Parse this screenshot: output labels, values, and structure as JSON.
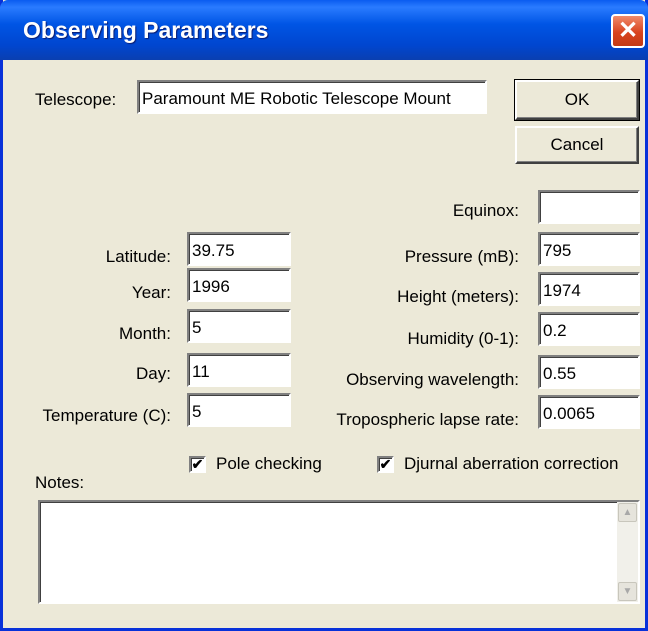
{
  "window": {
    "title": "Observing Parameters",
    "close_label": "✕"
  },
  "telescope": {
    "label": "Telescope:",
    "value": "Paramount ME Robotic Telescope Mount"
  },
  "buttons": {
    "ok": "OK",
    "cancel": "Cancel"
  },
  "left_fields": {
    "latitude": {
      "label": "Latitude:",
      "value": "39.75"
    },
    "year": {
      "label": "Year:",
      "value": "1996"
    },
    "month": {
      "label": "Month:",
      "value": "5"
    },
    "day": {
      "label": "Day:",
      "value": "11"
    },
    "temperature": {
      "label": "Temperature (C):",
      "value": "5"
    }
  },
  "right_fields": {
    "equinox": {
      "label": "Equinox:",
      "value": ""
    },
    "pressure": {
      "label": "Pressure (mB):",
      "value": "795"
    },
    "height": {
      "label": "Height (meters):",
      "value": "1974"
    },
    "humidity": {
      "label": "Humidity (0-1):",
      "value": "0.2"
    },
    "wavelength": {
      "label": "Observing wavelength:",
      "value": "0.55"
    },
    "lapse_rate": {
      "label": "Tropospheric lapse rate:",
      "value": "0.0065"
    }
  },
  "checkboxes": {
    "pole_checking": {
      "label": "Pole checking",
      "checked": true,
      "mark": "✔"
    },
    "diurnal": {
      "label": "Djurnal aberration correction",
      "checked": true,
      "mark": "✔"
    }
  },
  "notes": {
    "label": "Notes:",
    "value": "",
    "scroll_up_icon": "▲",
    "scroll_down_icon": "▼"
  }
}
